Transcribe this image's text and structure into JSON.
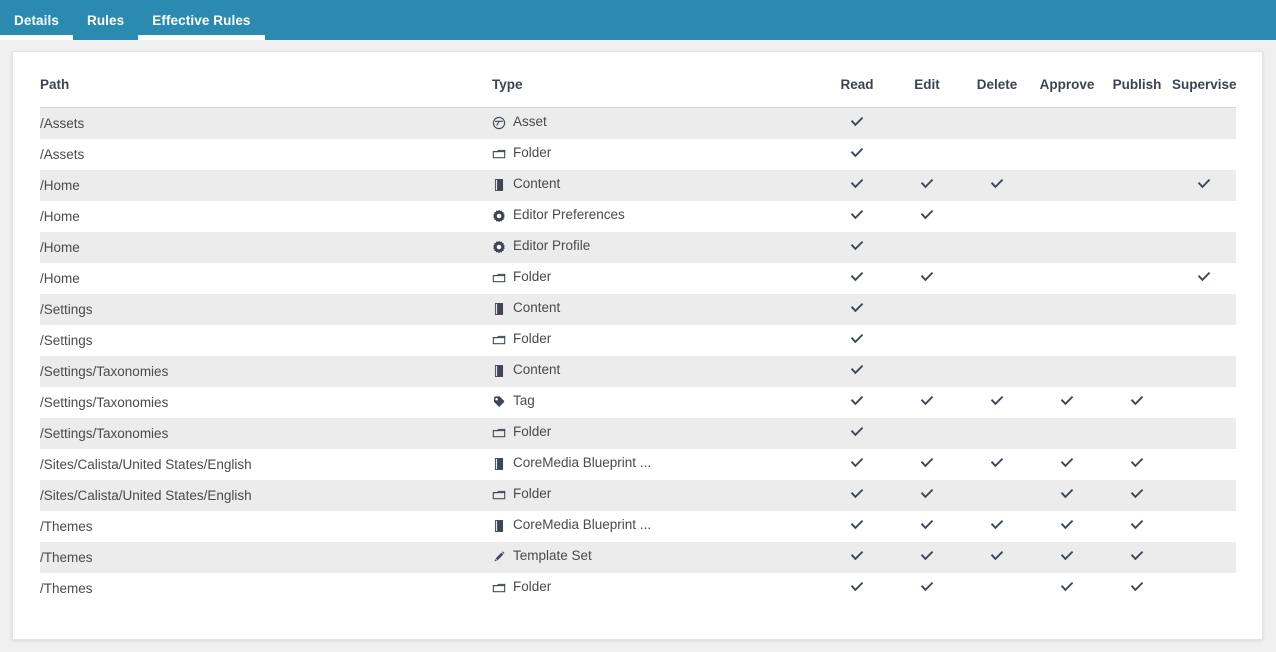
{
  "theme": {
    "tab_bar_bg": "#2b8ab0",
    "tab_text": "#ffffff",
    "card_bg": "#ffffff",
    "row_odd_bg": "#ececec",
    "row_even_bg": "#ffffff",
    "header_text": "#3d4450",
    "body_text": "#4a4a4a",
    "check_color": "#3c4655"
  },
  "tabs": [
    {
      "label": "Details",
      "active": true
    },
    {
      "label": "Rules",
      "active": false
    },
    {
      "label": "Effective Rules",
      "active": true
    }
  ],
  "table": {
    "columns": [
      {
        "key": "path",
        "label": "Path",
        "align": "left"
      },
      {
        "key": "type",
        "label": "Type",
        "align": "left"
      },
      {
        "key": "read",
        "label": "Read",
        "align": "center"
      },
      {
        "key": "edit",
        "label": "Edit",
        "align": "center"
      },
      {
        "key": "delete",
        "label": "Delete",
        "align": "center"
      },
      {
        "key": "approve",
        "label": "Approve",
        "align": "center"
      },
      {
        "key": "publish",
        "label": "Publish",
        "align": "center"
      },
      {
        "key": "supervise",
        "label": "Supervise",
        "align": "center"
      }
    ],
    "rows": [
      {
        "path": "/Assets",
        "type": "Asset",
        "icon": "asset-icon",
        "read": true,
        "edit": false,
        "delete": false,
        "approve": false,
        "publish": false,
        "supervise": false
      },
      {
        "path": "/Assets",
        "type": "Folder",
        "icon": "folder-icon",
        "read": true,
        "edit": false,
        "delete": false,
        "approve": false,
        "publish": false,
        "supervise": false
      },
      {
        "path": "/Home",
        "type": "Content",
        "icon": "content-icon",
        "read": true,
        "edit": true,
        "delete": true,
        "approve": false,
        "publish": false,
        "supervise": true
      },
      {
        "path": "/Home",
        "type": "Editor Preferences",
        "icon": "gear-icon",
        "read": true,
        "edit": true,
        "delete": false,
        "approve": false,
        "publish": false,
        "supervise": false
      },
      {
        "path": "/Home",
        "type": "Editor Profile",
        "icon": "gear-icon",
        "read": true,
        "edit": false,
        "delete": false,
        "approve": false,
        "publish": false,
        "supervise": false
      },
      {
        "path": "/Home",
        "type": "Folder",
        "icon": "folder-icon",
        "read": true,
        "edit": true,
        "delete": false,
        "approve": false,
        "publish": false,
        "supervise": true
      },
      {
        "path": "/Settings",
        "type": "Content",
        "icon": "content-icon",
        "read": true,
        "edit": false,
        "delete": false,
        "approve": false,
        "publish": false,
        "supervise": false
      },
      {
        "path": "/Settings",
        "type": "Folder",
        "icon": "folder-icon",
        "read": true,
        "edit": false,
        "delete": false,
        "approve": false,
        "publish": false,
        "supervise": false
      },
      {
        "path": "/Settings/Taxonomies",
        "type": "Content",
        "icon": "content-icon",
        "read": true,
        "edit": false,
        "delete": false,
        "approve": false,
        "publish": false,
        "supervise": false
      },
      {
        "path": "/Settings/Taxonomies",
        "type": "Tag",
        "icon": "tag-icon",
        "read": true,
        "edit": true,
        "delete": true,
        "approve": true,
        "publish": true,
        "supervise": false
      },
      {
        "path": "/Settings/Taxonomies",
        "type": "Folder",
        "icon": "folder-icon",
        "read": true,
        "edit": false,
        "delete": false,
        "approve": false,
        "publish": false,
        "supervise": false
      },
      {
        "path": "/Sites/Calista/United States/English",
        "type": "CoreMedia Blueprint ...",
        "icon": "content-icon",
        "read": true,
        "edit": true,
        "delete": true,
        "approve": true,
        "publish": true,
        "supervise": false
      },
      {
        "path": "/Sites/Calista/United States/English",
        "type": "Folder",
        "icon": "folder-icon",
        "read": true,
        "edit": true,
        "delete": false,
        "approve": true,
        "publish": true,
        "supervise": false
      },
      {
        "path": "/Themes",
        "type": "CoreMedia Blueprint ...",
        "icon": "content-icon",
        "read": true,
        "edit": true,
        "delete": true,
        "approve": true,
        "publish": true,
        "supervise": false
      },
      {
        "path": "/Themes",
        "type": "Template Set",
        "icon": "template-set-icon",
        "read": true,
        "edit": true,
        "delete": true,
        "approve": true,
        "publish": true,
        "supervise": false
      },
      {
        "path": "/Themes",
        "type": "Folder",
        "icon": "folder-icon",
        "read": true,
        "edit": true,
        "delete": false,
        "approve": true,
        "publish": true,
        "supervise": false
      }
    ]
  }
}
